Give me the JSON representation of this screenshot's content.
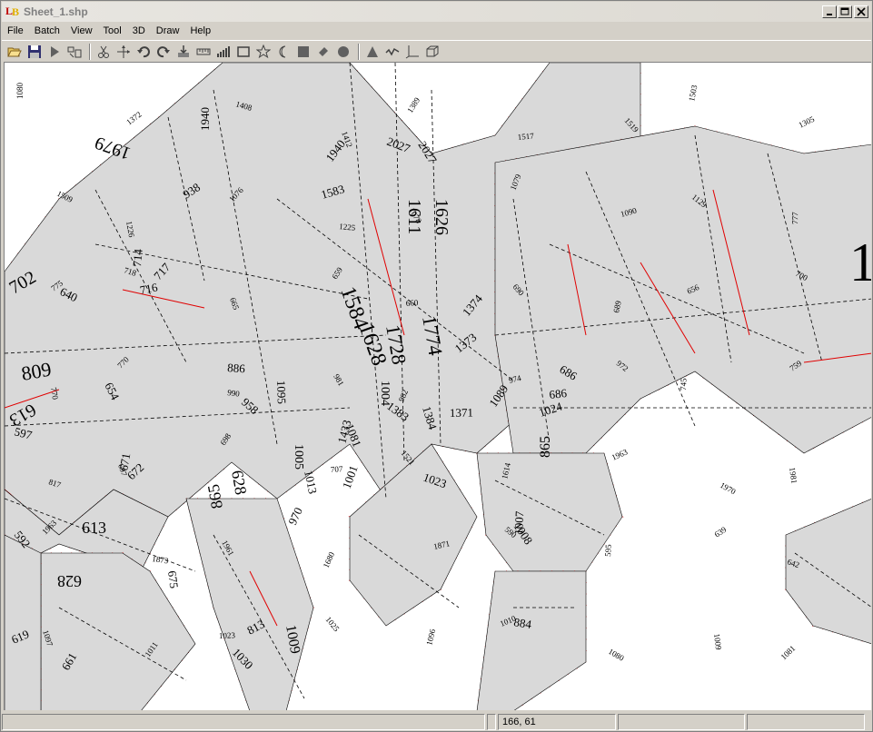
{
  "window": {
    "title": "Sheet_1.shp",
    "app_icon_letters": [
      "L",
      "B"
    ]
  },
  "window_buttons": {
    "minimize": "0",
    "maximize": "1",
    "close": "r"
  },
  "menu": [
    "File",
    "Batch",
    "View",
    "Tool",
    "3D",
    "Draw",
    "Help"
  ],
  "toolbar": [
    "open-folder-icon",
    "save-icon",
    "play-icon",
    "layout-icon",
    "scissors-icon",
    "move-icon",
    "undo-icon",
    "redo-icon",
    "import-icon",
    "ruler-icon",
    "bar-chart-icon",
    "rectangle-icon",
    "star-icon",
    "moon-icon",
    "filled-square-icon",
    "pencil-icon",
    "circle-icon",
    "triangle-icon",
    "wave-icon",
    "axes-icon",
    "cube-icon"
  ],
  "status": {
    "pane1": "",
    "pane2": "",
    "coords": "166, 61",
    "pane4": "",
    "pane5": ""
  },
  "labels": {
    "big": [
      "1584",
      "1628",
      "1728",
      "1774",
      "1611",
      "1626",
      "1979",
      "702",
      "809",
      "613",
      "613",
      "628",
      "628",
      "865",
      "865",
      "1005",
      "1004",
      "1009",
      "1133",
      "1"
    ],
    "med": [
      "1940",
      "1940",
      "1583",
      "2027",
      "2027",
      "714",
      "717",
      "716",
      "640",
      "654",
      "671",
      "672",
      "686",
      "686",
      "1081",
      "1433",
      "1373",
      "1371",
      "1383",
      "1384",
      "1001",
      "938",
      "886",
      "958",
      "1013",
      "970",
      "813",
      "884",
      "1030",
      "675",
      "661",
      "619",
      "597",
      "592",
      "1095",
      "1089",
      "1024",
      "1023",
      "1008",
      "1007",
      "1374"
    ],
    "small": [
      "1080",
      "1372",
      "1408",
      "1412",
      "1389",
      "1517",
      "1519",
      "1503",
      "1305",
      "1509",
      "1226",
      "1076",
      "1225",
      "1078",
      "1079",
      "1090",
      "1129",
      "777",
      "775",
      "718",
      "665",
      "659",
      "660",
      "690",
      "689",
      "656",
      "700",
      "770",
      "770",
      "990",
      "981",
      "982",
      "974",
      "972",
      "745",
      "759",
      "817",
      "697",
      "698",
      "707",
      "1521",
      "1614",
      "1963",
      "1970",
      "1981",
      "1963",
      "1873",
      "1961",
      "1680",
      "1871",
      "590",
      "595",
      "639",
      "642",
      "1097",
      "1011",
      "1023",
      "1025",
      "1096",
      "1010",
      "1080",
      "1009",
      "1081"
    ]
  }
}
